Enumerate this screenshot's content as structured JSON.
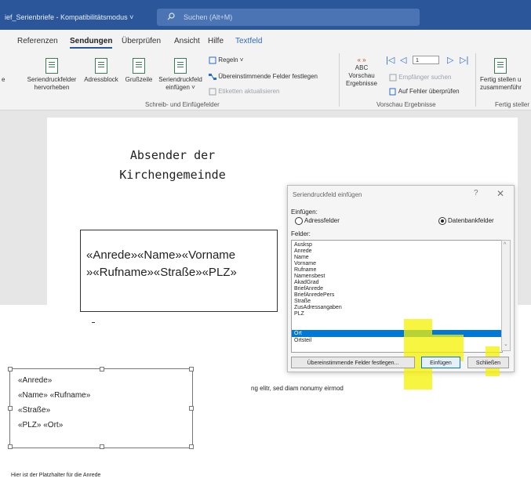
{
  "titlebar": {
    "title": "ief_Serienbriefe  -  Kompatibilitätsmodus ˅",
    "search_placeholder": "Suchen (Alt+M)",
    "accent": "#2b579a"
  },
  "tabs": [
    "Referenzen",
    "Sendungen",
    "Überprüfen",
    "Ansicht",
    "Hilfe",
    "Textfeld"
  ],
  "ribbon": {
    "left_cut": "e",
    "big_buttons": [
      {
        "label1": "Seriendruckfelder",
        "label2": "hervorheben"
      },
      {
        "label1": "Adressblock",
        "label2": ""
      },
      {
        "label1": "Grußzeile",
        "label2": ""
      },
      {
        "label1": "Seriendruckfeld",
        "label2": "einfügen ˅"
      }
    ],
    "rules": "Regeln ˅",
    "match_fields": "Übereinstimmende Felder festlegen",
    "update_labels": "Etiketten aktualisieren",
    "group1": "Schreib- und Einfügefelder",
    "preview_abc": "ABC",
    "preview1": "Vorschau",
    "preview2": "Ergebnisse",
    "record_no": "1",
    "find_recipient": "Empfänger suchen",
    "check_errors": "Auf Fehler überprüfen",
    "group2": "Vorschau Ergebnisse",
    "finish1": "Fertig stellen u",
    "finish2": "zusammenführ",
    "group3": "Fertig steller"
  },
  "document": {
    "heading_line1": "Absender der",
    "heading_line2": "Kirchengemeinde",
    "field_line1": "«Anrede»«Name»«Vorname",
    "field_line2": "»«Rufname»«Straße»«PLZ»",
    "lower_lines": [
      "«Anrede»",
      "«Name» «Rufname»",
      "«Straße»",
      "«PLZ» «Ort»"
    ],
    "body_text": "ng elitr, sed diam nonumy eirmod",
    "footer": "Hier ist der Platzhalter für die Anrede"
  },
  "dialog": {
    "title": "Seriendruckfeld einfügen",
    "help": "?",
    "close": "✕",
    "insert_label": "Einfügen:",
    "radio_address": "Adressfelder",
    "radio_db": "Datenbankfelder",
    "fields_label": "Felder:",
    "fields": [
      "Ausksp",
      "Anrede",
      "Name",
      "Vorname",
      "Rufname",
      "Namensbest",
      "AkadGrad",
      "BriefAnrede",
      "BriefAnredePers",
      "Straße",
      "ZusAdressangaben",
      "PLZ",
      "Ort",
      "Ortsteil"
    ],
    "selected": "Ort",
    "btn_match": "Übereinstimmende Felder festlegen...",
    "btn_insert": "Einfügen",
    "btn_close": "Schließen",
    "selection_color": "#0078d7",
    "highlight_color": "#f6f100"
  }
}
